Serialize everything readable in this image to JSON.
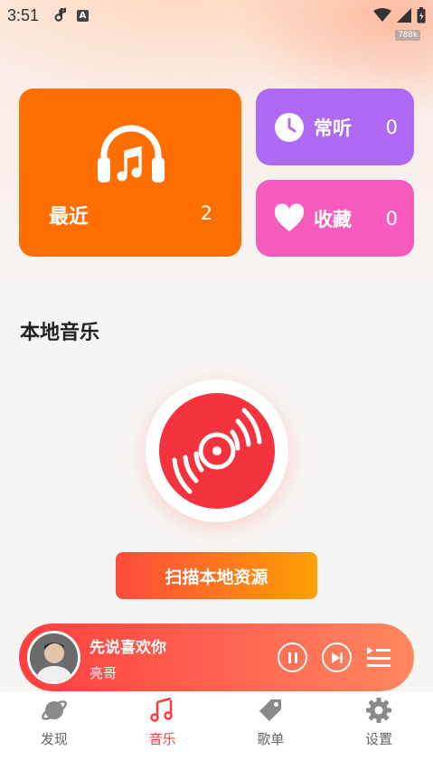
{
  "statusbar": {
    "time": "3:51",
    "speed": "788k"
  },
  "cards": {
    "recent": {
      "label": "最近",
      "count": "2"
    },
    "often": {
      "label": "常听",
      "count": "0"
    },
    "favorites": {
      "label": "收藏",
      "count": "0"
    }
  },
  "local_music": {
    "title": "本地音乐",
    "scan_button": "扫描本地资源"
  },
  "player": {
    "song": "先说喜欢你",
    "artist": "亮哥"
  },
  "tabs": [
    {
      "label": "发现",
      "icon": "planet-icon",
      "active": false
    },
    {
      "label": "音乐",
      "icon": "music-note-icon",
      "active": true
    },
    {
      "label": "歌单",
      "icon": "tag-icon",
      "active": false
    },
    {
      "label": "设置",
      "icon": "gear-icon",
      "active": false
    }
  ],
  "colors": {
    "accent": "#ff3b3b",
    "recent_card": "#ff6f00",
    "often_card": "#ae6af3",
    "favorites_card": "#f65bbd"
  }
}
